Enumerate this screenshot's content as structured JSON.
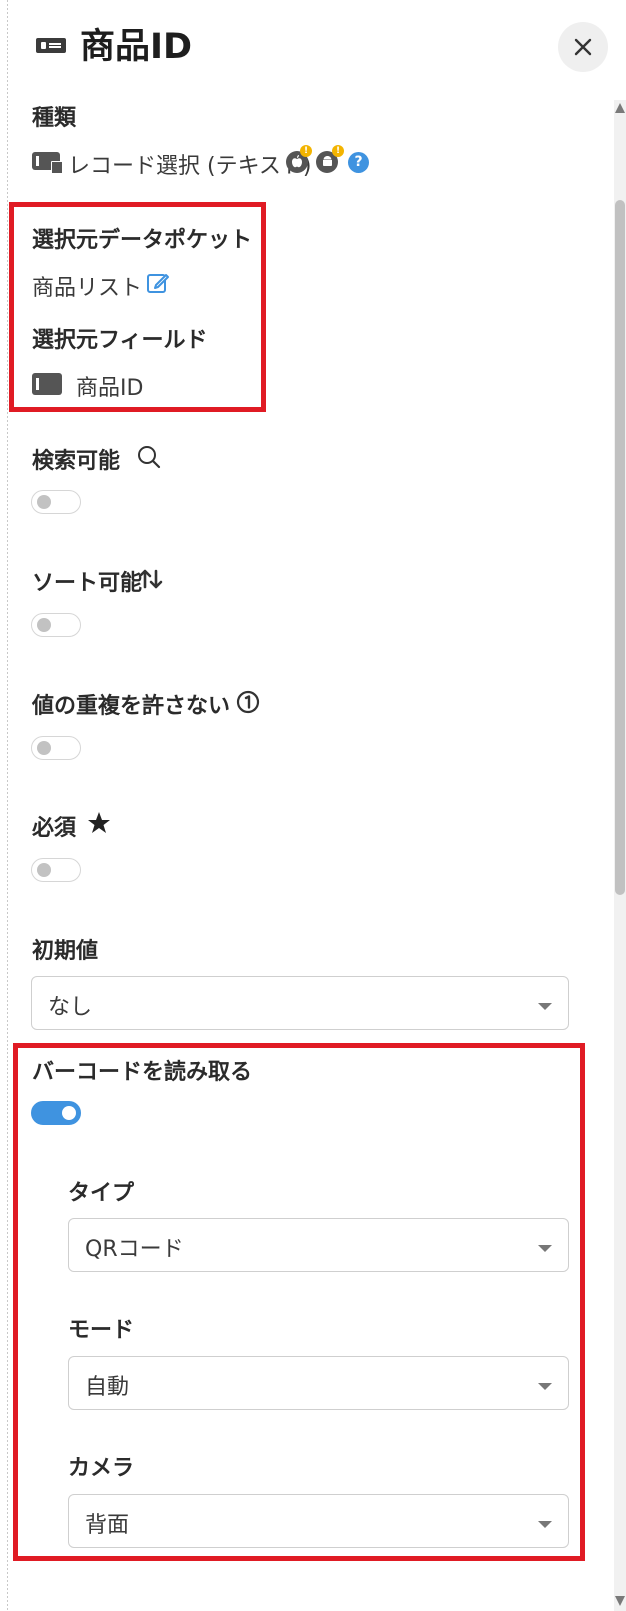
{
  "header": {
    "title": "商品ID",
    "close_icon": "close-icon",
    "field_icon": "text-field-icon"
  },
  "type_section": {
    "label": "種類",
    "value": "レコード選択 (テキスト)",
    "icons": [
      "record-select-icon",
      "apple-icon",
      "android-icon",
      "help-icon"
    ],
    "help_glyph": "?"
  },
  "source": {
    "pocket_label": "選択元データポケット",
    "pocket_value": "商品リスト",
    "field_label": "選択元フィールド",
    "field_value": "商品ID"
  },
  "searchable": {
    "label": "検索可能",
    "on": false
  },
  "sortable": {
    "label": "ソート可能",
    "on": false
  },
  "unique": {
    "label": "値の重複を許さない",
    "on": false
  },
  "required": {
    "label": "必須",
    "on": false
  },
  "initial_value": {
    "label": "初期値",
    "selected": "なし"
  },
  "barcode": {
    "label": "バーコードを読み取る",
    "on": true,
    "type_label": "タイプ",
    "type_selected": "QRコード",
    "mode_label": "モード",
    "mode_selected": "自動",
    "camera_label": "カメラ",
    "camera_selected": "背面"
  },
  "colors": {
    "accent": "#3f93e0",
    "highlight": "#e01b24",
    "warning": "#f3b400"
  }
}
